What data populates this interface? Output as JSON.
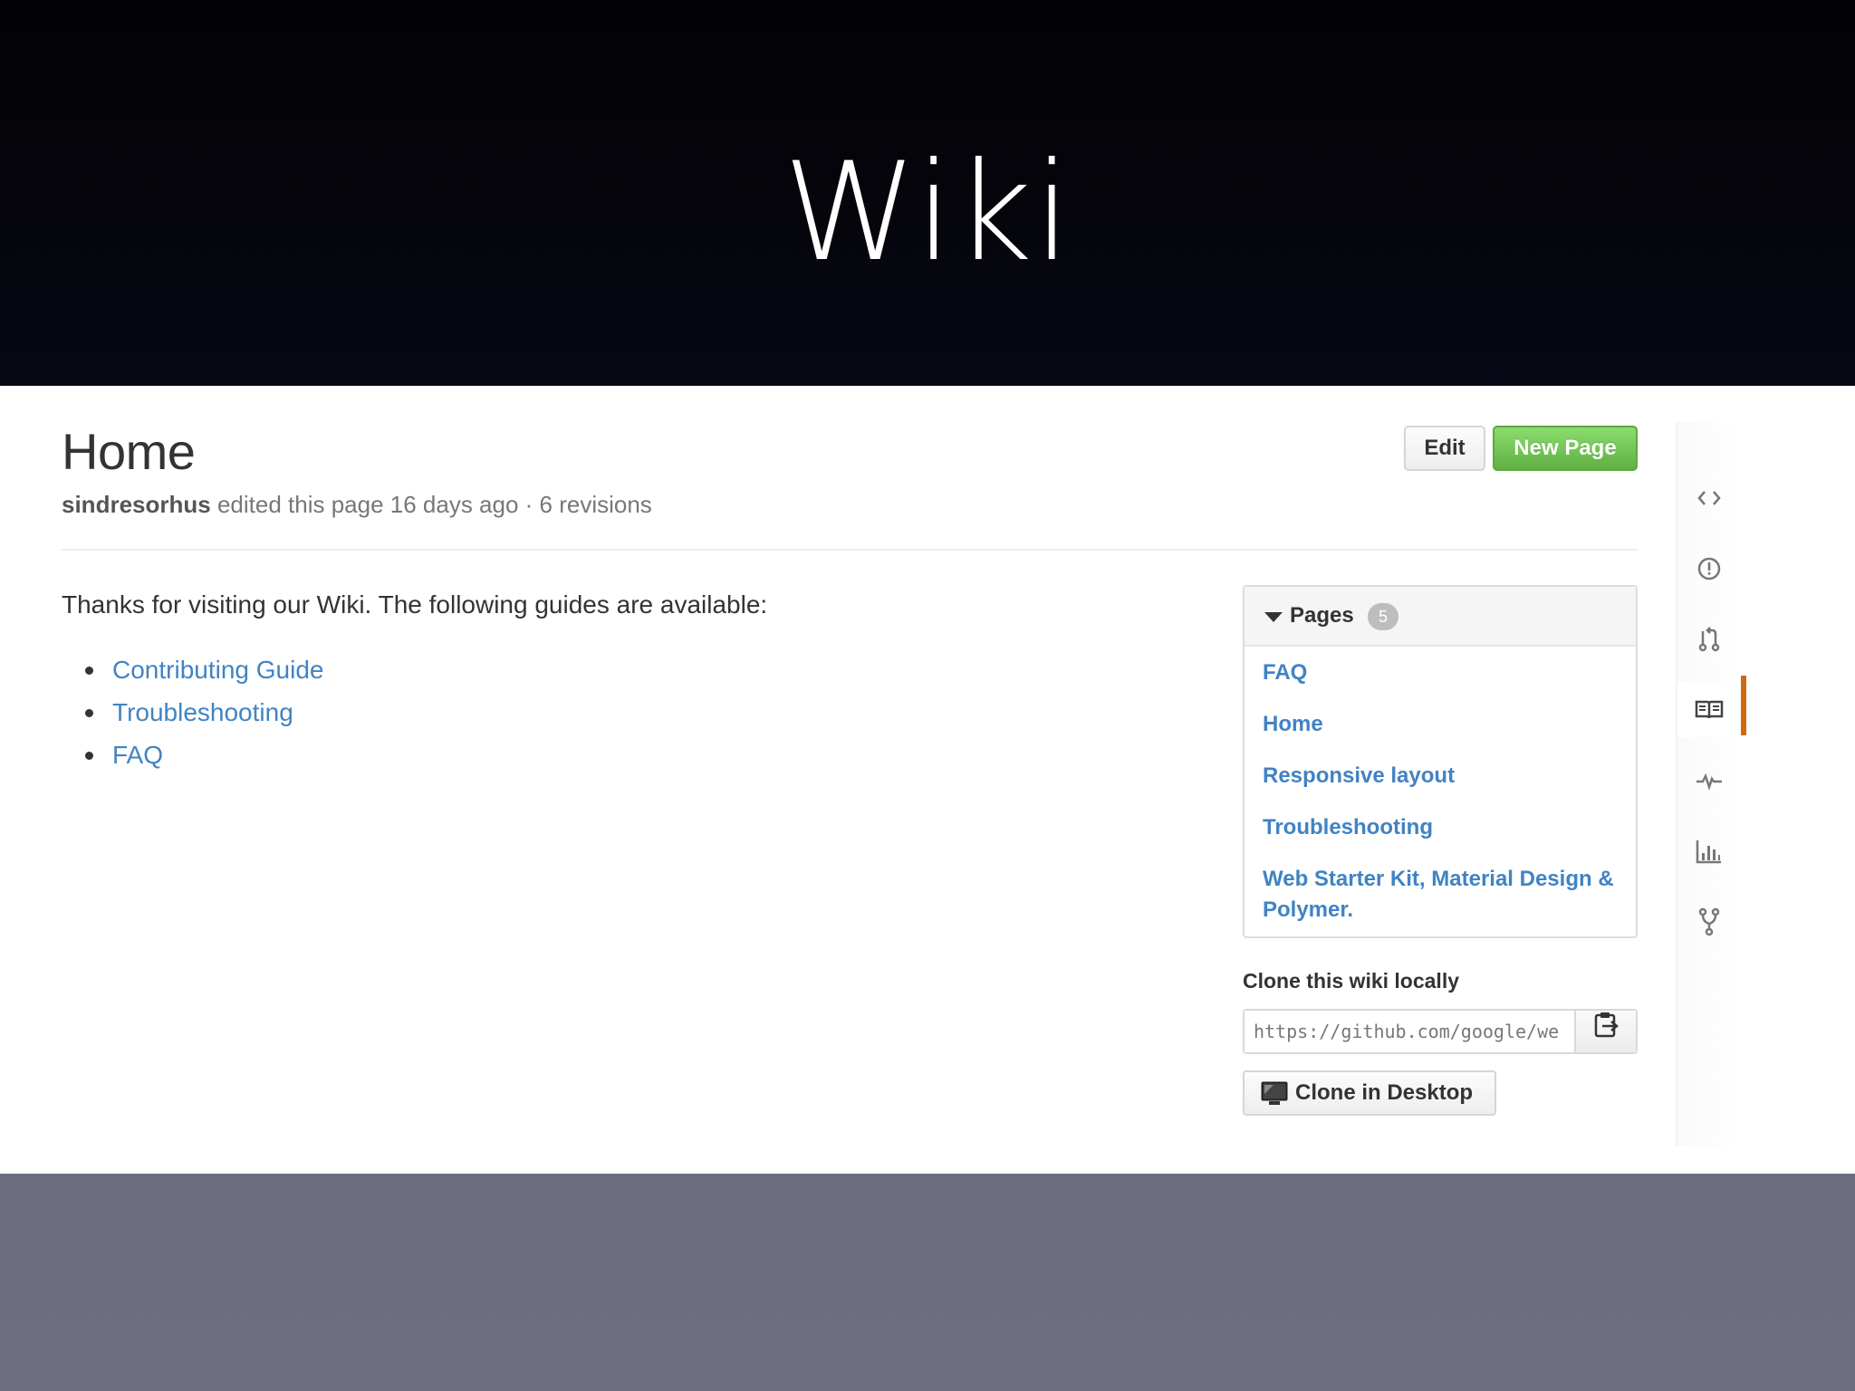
{
  "slide": {
    "title": "Wiki"
  },
  "wiki": {
    "page_title": "Home",
    "author": "sindresorhus",
    "edit_meta": "edited this page 16 days ago · 6 revisions",
    "edit_button": "Edit",
    "new_page_button": "New Page",
    "intro": "Thanks for visiting our Wiki. The following guides are available:",
    "guides": [
      "Contributing Guide",
      "Troubleshooting",
      "FAQ"
    ]
  },
  "sidebar": {
    "pages_label": "Pages",
    "pages_count": "5",
    "pages": [
      "FAQ",
      "Home",
      "Responsive layout",
      "Troubleshooting",
      "Web Starter Kit, Material Design & Polymer."
    ],
    "clone_label": "Clone this wiki locally",
    "clone_url": "https://github.com/google/we",
    "clone_desktop_button": "Clone in Desktop"
  },
  "rail": {
    "icons": [
      "code-icon",
      "issues-icon",
      "pull-request-icon",
      "wiki-icon",
      "pulse-icon",
      "graphs-icon",
      "fork-icon"
    ],
    "selected": "wiki-icon"
  },
  "colors": {
    "link": "#4183c4",
    "new_page_green": "#60b044",
    "rail_selected_accent": "#d26911",
    "slide_bottom": "#6c6c80"
  }
}
